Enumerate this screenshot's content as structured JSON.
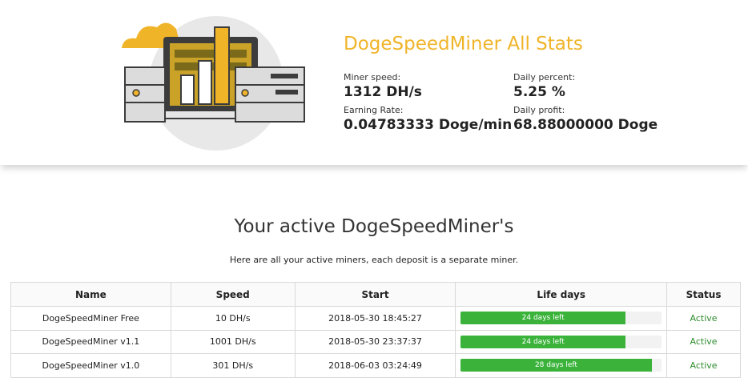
{
  "stats": {
    "title": "DogeSpeedMiner All Stats",
    "miner_speed_label": "Miner speed:",
    "miner_speed_value": "1312 DH/s",
    "daily_percent_label": "Daily percent:",
    "daily_percent_value": "5.25 %",
    "earning_rate_label": "Earning Rate:",
    "earning_rate_value": "0.04783333 Doge/min",
    "daily_profit_label": "Daily profit:",
    "daily_profit_value": "68.88000000 Doge"
  },
  "colors": {
    "accent": "#f0b429",
    "progress": "#3bb33b",
    "status": "#2e8b2e"
  },
  "section": {
    "title": "Your active DogeSpeedMiner's",
    "subtitle": "Here are all your active miners, each deposit is a separate miner."
  },
  "table": {
    "headers": [
      "Name",
      "Speed",
      "Start",
      "Life days",
      "Status"
    ],
    "rows": [
      {
        "name": "DogeSpeedMiner Free",
        "speed": "10 DH/s",
        "start": "2018-05-30 18:45:27",
        "life": "24 days left",
        "progress": 0.82,
        "status": "Active"
      },
      {
        "name": "DogeSpeedMiner v1.1",
        "speed": "1001 DH/s",
        "start": "2018-05-30 23:37:37",
        "life": "24 days left",
        "progress": 0.82,
        "status": "Active"
      },
      {
        "name": "DogeSpeedMiner v1.0",
        "speed": "301 DH/s",
        "start": "2018-06-03 03:24:49",
        "life": "28 days left",
        "progress": 0.95,
        "status": "Active"
      }
    ]
  }
}
